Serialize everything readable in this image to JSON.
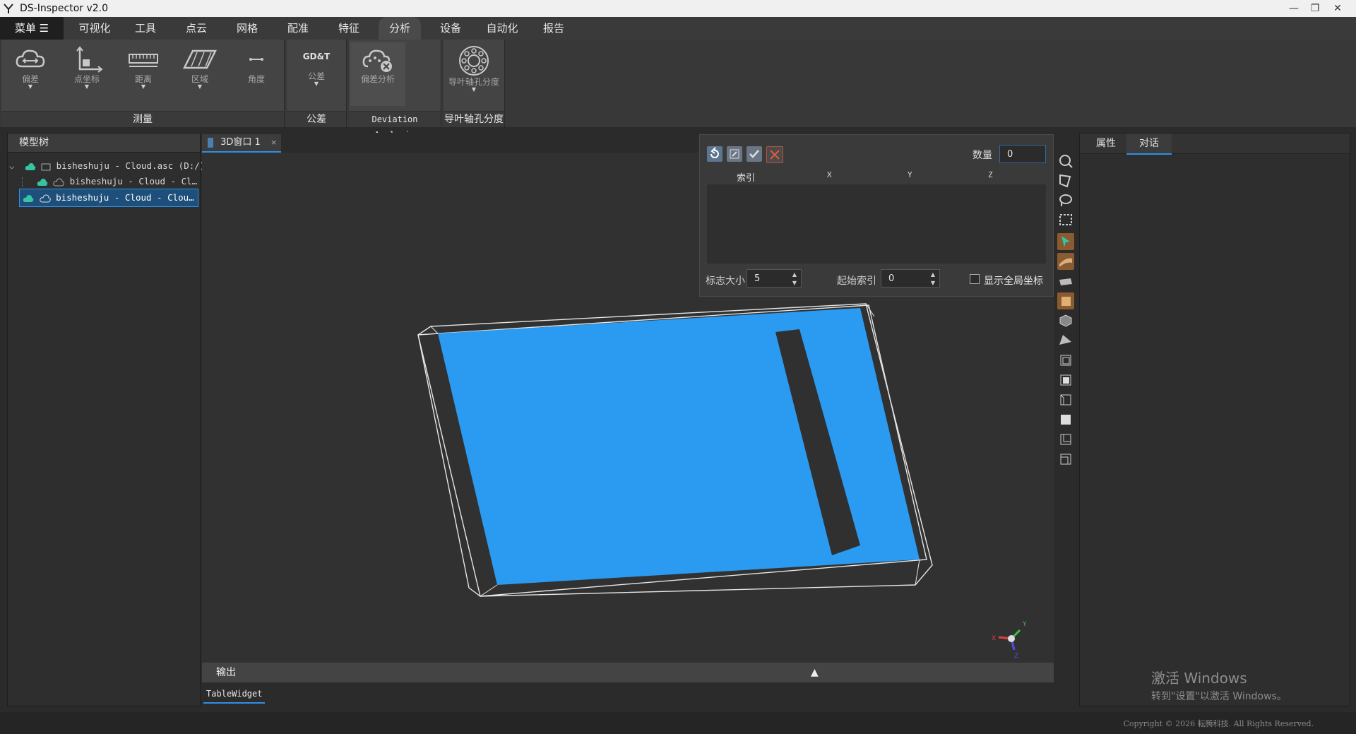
{
  "app": {
    "title": "DS-Inspector v2.0"
  },
  "menu": {
    "main_label": "菜单 ☰",
    "items": [
      "可视化",
      "工具",
      "点云",
      "网格",
      "配准",
      "特征",
      "分析",
      "设备",
      "自动化",
      "报告"
    ],
    "active_index": 6
  },
  "ribbon": {
    "groups": [
      {
        "label": "测量",
        "buttons": [
          {
            "label": "偏差",
            "icon": "deviation-cloud-icon",
            "has_dropdown": true
          },
          {
            "label": "点坐标",
            "icon": "point-coordinate-icon",
            "has_dropdown": true
          },
          {
            "label": "距离",
            "icon": "ruler-icon",
            "has_dropdown": true
          },
          {
            "label": "区域",
            "icon": "area-parallelogram-icon",
            "has_dropdown": true
          },
          {
            "label": "角度",
            "icon": "angle-icon",
            "has_dropdown": false
          }
        ]
      },
      {
        "label": "公差",
        "buttons": [
          {
            "label": "公差",
            "icon_text": "GD&T",
            "icon": "gdt-icon",
            "has_dropdown": true
          }
        ]
      },
      {
        "label": "Deviation Analysis",
        "buttons": [
          {
            "label": "偏差分析",
            "icon": "deviation-analysis-icon",
            "has_dropdown": false
          }
        ]
      },
      {
        "label": "导叶轴孔分度",
        "buttons": [
          {
            "label": "导叶轴孔分度",
            "icon": "vane-hole-icon",
            "has_dropdown": true
          }
        ]
      }
    ]
  },
  "model_tree": {
    "title": "模型树",
    "items": [
      {
        "label": "bisheshuju - Cloud.asc (D:/)",
        "level": 0,
        "selected": false
      },
      {
        "label": "bisheshuju - Cloud - Cl…",
        "level": 1,
        "selected": false
      },
      {
        "label": "bisheshuju - Cloud - Clou…",
        "level": 0,
        "selected": true
      }
    ]
  },
  "viewport": {
    "tab_label": "3D窗口 1",
    "close_symbol": "×",
    "cloud_color": "#2a9bf0",
    "axis_labels": {
      "x": "X",
      "y": "Y",
      "z": "Z"
    }
  },
  "point_panel": {
    "count_label": "数量",
    "count_value": "0",
    "columns": [
      "索引",
      "X",
      "Y",
      "Z"
    ],
    "marker_size_label": "标志大小",
    "marker_size_value": "5",
    "start_index_label": "起始索引",
    "start_index_value": "0",
    "global_coord_label": "显示全局坐标",
    "global_coord_checked": false
  },
  "right_panel": {
    "tabs": [
      "属性",
      "对话"
    ],
    "active_tab": 1
  },
  "output": {
    "title": "输出",
    "tab": "TableWidget"
  },
  "watermark": {
    "line1": "激活 Windows",
    "line2": "转到\"设置\"以激活 Windows。"
  },
  "statusbar": {
    "copyright": "Copyright © 2026 耘腾科技. All Rights Reserved."
  }
}
